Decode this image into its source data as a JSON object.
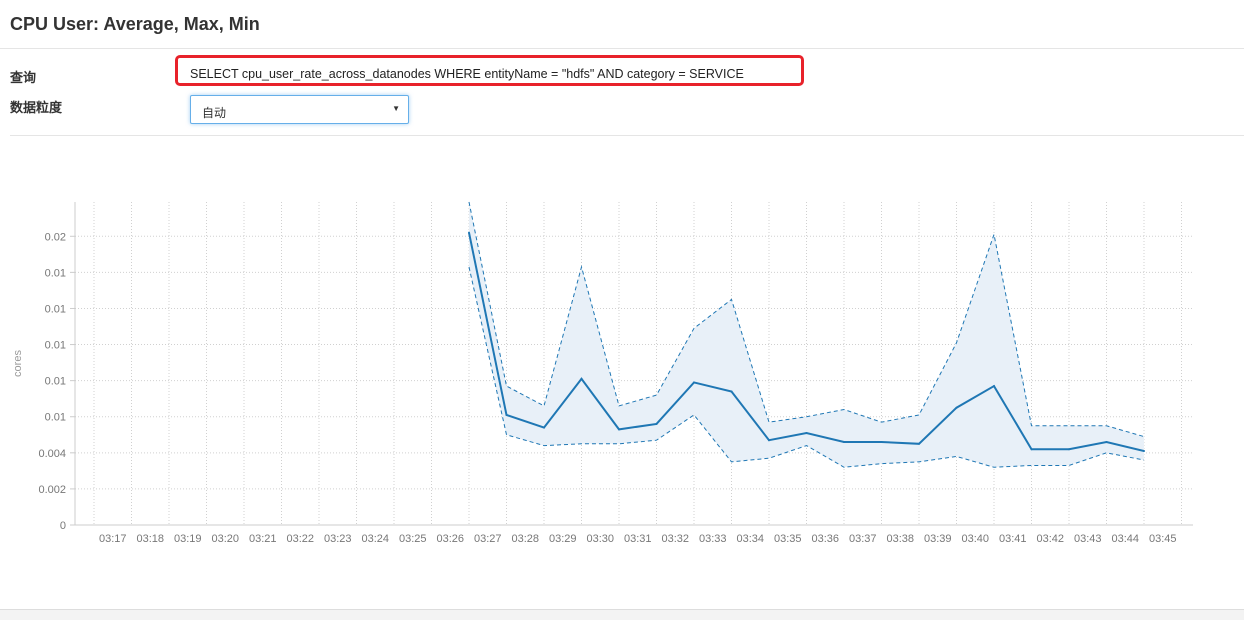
{
  "header": {
    "title": "CPU User: Average, Max, Min"
  },
  "form": {
    "query_label": "查询",
    "query_value": "SELECT cpu_user_rate_across_datanodes WHERE entityName = \"hdfs\" AND category = SERVICE",
    "granularity_label": "数据粒度",
    "granularity_value": "自动"
  },
  "chart_data": {
    "type": "area",
    "ylabel": "cores",
    "y_tick_values": [
      0,
      0.002,
      0.004,
      0.006,
      0.008,
      0.01,
      0.012,
      0.014,
      0.016
    ],
    "y_tick_labels": [
      "0",
      "0.002",
      "0.004",
      "0.01",
      "0.01",
      "0.01",
      "0.01",
      "0.01",
      "0.02"
    ],
    "ylim": [
      0,
      0.0179
    ],
    "x_labels": [
      "03:17",
      "03:18",
      "03:19",
      "03:20",
      "03:21",
      "03:22",
      "03:23",
      "03:24",
      "03:25",
      "03:26",
      "03:27",
      "03:28",
      "03:29",
      "03:30",
      "03:31",
      "03:32",
      "03:33",
      "03:34",
      "03:35",
      "03:36",
      "03:37",
      "03:38",
      "03:39",
      "03:40",
      "03:41",
      "03:42",
      "03:43",
      "03:44",
      "03:45"
    ],
    "grid": true,
    "series": [
      {
        "name": "",
        "style": "solid",
        "color": "#1f77b4",
        "x": [
          "03:27",
          "03:28",
          "03:29",
          "03:30",
          "03:31",
          "03:32",
          "03:33",
          "03:34",
          "03:35",
          "03:36",
          "03:37",
          "03:38",
          "03:39",
          "03:40",
          "03:41",
          "03:42",
          "03:43",
          "03:44",
          "03:45"
        ],
        "values": [
          0.0162,
          0.0061,
          0.0054,
          0.0081,
          0.0053,
          0.0056,
          0.0079,
          0.0074,
          0.0047,
          0.0051,
          0.0046,
          0.0046,
          0.0045,
          0.0065,
          0.0077,
          0.0042,
          0.0042,
          0.0046,
          0.0041
        ]
      },
      {
        "name": "",
        "style": "dashed",
        "color": "#1f77b4",
        "x": [
          "03:27",
          "03:28",
          "03:29",
          "03:30",
          "03:31",
          "03:32",
          "03:33",
          "03:34",
          "03:35",
          "03:36",
          "03:37",
          "03:38",
          "03:39",
          "03:40",
          "03:41",
          "03:42",
          "03:43",
          "03:44",
          "03:45"
        ],
        "values": [
          0.0179,
          0.0077,
          0.0066,
          0.0143,
          0.0066,
          0.0072,
          0.0109,
          0.0125,
          0.0057,
          0.006,
          0.0064,
          0.0057,
          0.0061,
          0.0101,
          0.0161,
          0.0055,
          0.0055,
          0.0055,
          0.0049
        ]
      },
      {
        "name": "",
        "style": "dashed",
        "color": "#1f77b4",
        "x": [
          "03:27",
          "03:28",
          "03:29",
          "03:30",
          "03:31",
          "03:32",
          "03:33",
          "03:34",
          "03:35",
          "03:36",
          "03:37",
          "03:38",
          "03:39",
          "03:40",
          "03:41",
          "03:42",
          "03:43",
          "03:44",
          "03:45"
        ],
        "values": [
          0.0143,
          0.005,
          0.0044,
          0.0045,
          0.0045,
          0.0047,
          0.0061,
          0.0035,
          0.0037,
          0.0044,
          0.0032,
          0.0034,
          0.0035,
          0.0038,
          0.0032,
          0.0033,
          0.0033,
          0.004,
          0.0036
        ]
      }
    ],
    "band_fill": "#e8f0f8"
  }
}
